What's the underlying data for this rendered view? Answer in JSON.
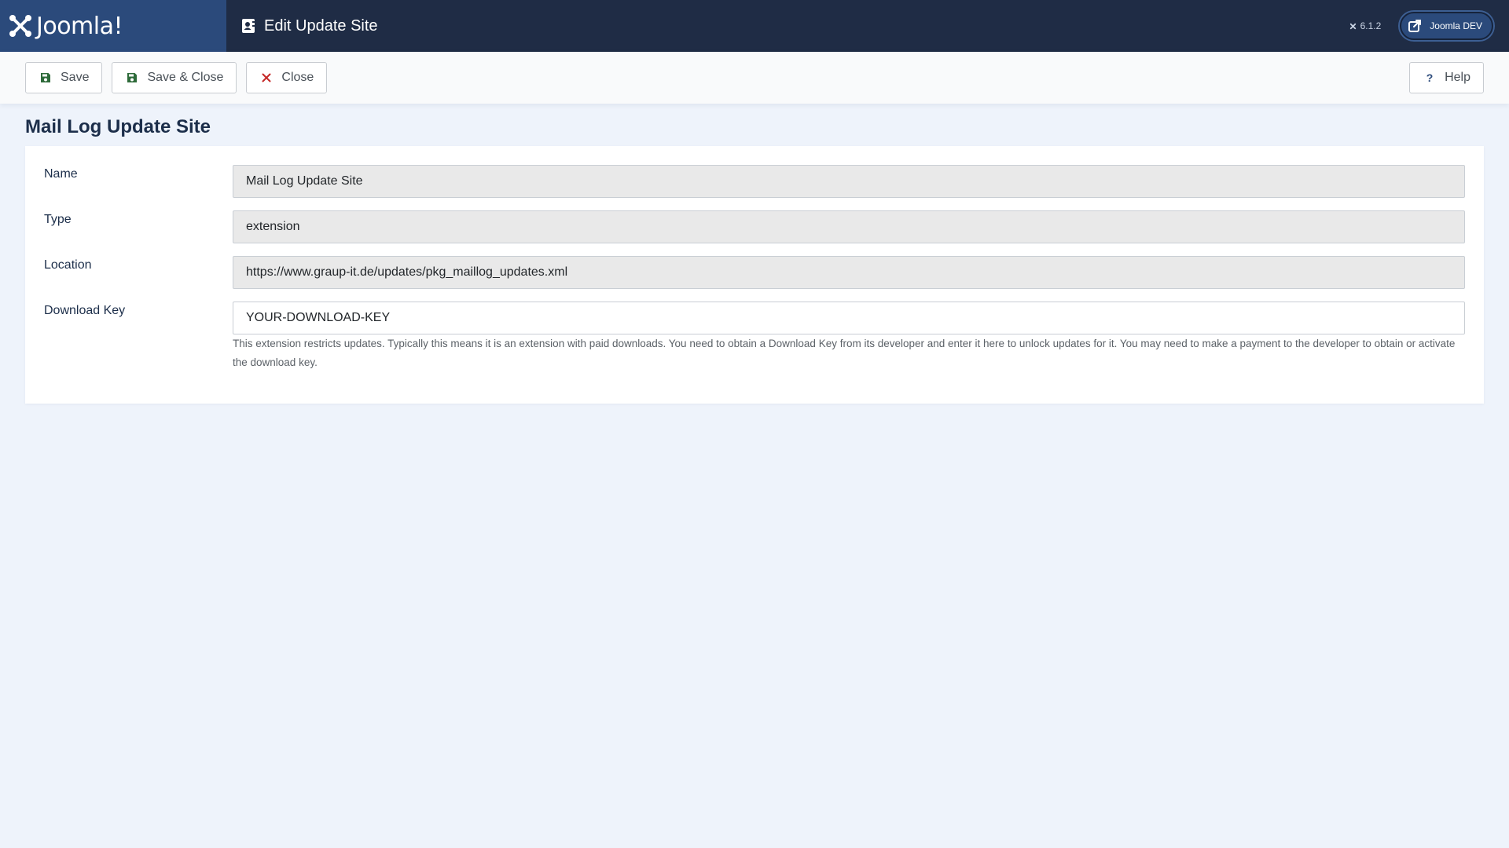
{
  "header": {
    "brand": "Joomla!",
    "page_title": "Edit Update Site",
    "version": "6.1.2",
    "site_button": "Joomla DEV",
    "colors": {
      "bar": "#1f2c45",
      "brand_bg": "#2b4a7b"
    }
  },
  "toolbar": {
    "save_label": "Save",
    "save_close_label": "Save & Close",
    "close_label": "Close",
    "help_label": "Help",
    "icons": [
      "save-icon",
      "save-close-icon",
      "close-x-icon",
      "question-icon"
    ]
  },
  "main": {
    "title": "Mail Log Update Site",
    "fields": {
      "name": {
        "label": "Name",
        "value": "Mail Log Update Site"
      },
      "type": {
        "label": "Type",
        "value": "extension"
      },
      "location": {
        "label": "Location",
        "value": "https://www.graup-it.de/updates/pkg_maillog_updates.xml"
      },
      "download_key": {
        "label": "Download Key",
        "value": "YOUR-DOWNLOAD-KEY",
        "hint": "This extension restricts updates. Typically this means it is an extension with paid downloads. You need to obtain a Download Key from its developer and enter it here to unlock updates for it. You may need to make a payment to the developer to obtain or activate the download key."
      }
    }
  }
}
